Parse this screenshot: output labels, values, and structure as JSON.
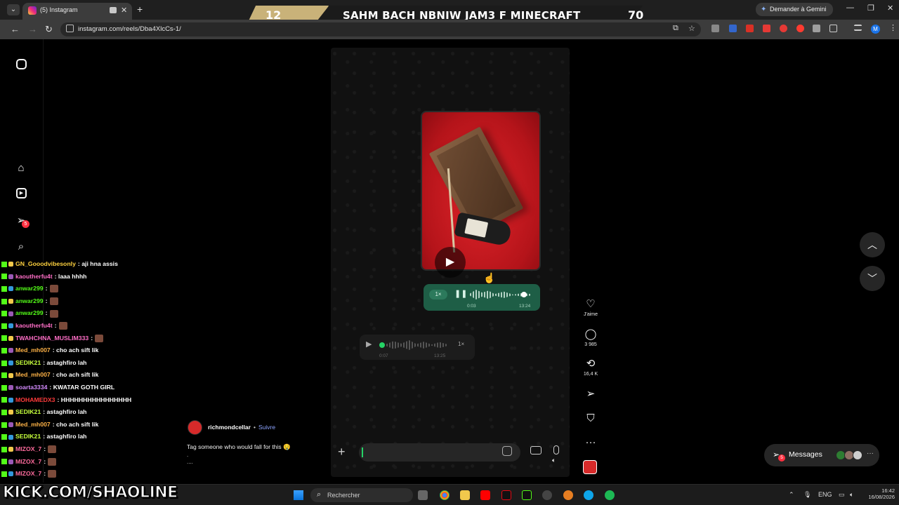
{
  "browser": {
    "tab_title": "(5) Instagram",
    "new_tab": "+",
    "url": "instagram.com/reels/Dba4XlcCs-1/",
    "gemini_label": "Demander à Gemini",
    "profile_initial": "M"
  },
  "banner": {
    "left_score": "12",
    "title": "SAHM BACH NBNIW JAM3 F MINECRAFT",
    "right_score": "70"
  },
  "reel": {
    "voice_note_1": {
      "speed": "1×",
      "elapsed": "0:03",
      "time": "13:24"
    },
    "voice_note_2": {
      "speed": "1×",
      "elapsed": "0:07",
      "time": "13:25"
    }
  },
  "actions": {
    "like_label": "J'aime",
    "comments_count": "3 985",
    "reposts_count": "16,4 K"
  },
  "caption": {
    "username": "richmondcellar",
    "follow": "Suivre",
    "separator": "•",
    "text": "Tag someone who would fall for this 🤤",
    "more1": ".",
    "more2": "...."
  },
  "messages": {
    "label": "Messages",
    "badge": "5"
  },
  "notifications_badge": "5",
  "chat": [
    {
      "user": "GN_Gooodvibesonly",
      "color": "#ffd23f",
      "msg": ": aji hna assis",
      "emote": false
    },
    {
      "user": "kaoutherfu4t",
      "color": "#ff6ec7",
      "msg": ": laaa hhhh",
      "emote": false
    },
    {
      "user": "anwar299",
      "color": "#53fc18",
      "msg": ":",
      "emote": true
    },
    {
      "user": "anwar299",
      "color": "#53fc18",
      "msg": ":",
      "emote": true
    },
    {
      "user": "anwar299",
      "color": "#53fc18",
      "msg": ":",
      "emote": true
    },
    {
      "user": "kaoutherfu4t",
      "color": "#ff6ec7",
      "msg": ":",
      "emote": true
    },
    {
      "user": "TWAHCHNA_MUSLIM333",
      "color": "#ff6ec7",
      "msg": ":",
      "emote": true
    },
    {
      "user": "Med_mh007",
      "color": "#ffb347",
      "msg": ": cho ach sift lik",
      "emote": false
    },
    {
      "user": "SEDIK21",
      "color": "#c6ff3d",
      "msg": ": astaghfiro lah",
      "emote": false
    },
    {
      "user": "Med_mh007",
      "color": "#ffb347",
      "msg": ": cho ach sift lik",
      "emote": false
    },
    {
      "user": "soarta3334",
      "color": "#d58cff",
      "msg": ": KWATAR GOTH GIRL",
      "emote": false
    },
    {
      "user": "MOHAMEDX3",
      "color": "#ff3b3b",
      "msg": ": HHHHHHHHHHHHHHHH",
      "emote": false
    },
    {
      "user": "SEDIK21",
      "color": "#c6ff3d",
      "msg": ": astaghfiro lah",
      "emote": false
    },
    {
      "user": "Med_mh007",
      "color": "#ffb347",
      "msg": ": cho ach sift lik",
      "emote": false
    },
    {
      "user": "SEDIK21",
      "color": "#c6ff3d",
      "msg": ": astaghfiro lah",
      "emote": false
    },
    {
      "user": "MIZOX_7",
      "color": "#ff6b9d",
      "msg": ":",
      "emote": true
    },
    {
      "user": "MIZOX_7",
      "color": "#ff6b9d",
      "msg": ":",
      "emote": true
    },
    {
      "user": "MIZOX_7",
      "color": "#ff6b9d",
      "msg": ":",
      "emote": true
    }
  ],
  "kick": {
    "k": "K",
    "rest": "KICK.COM/SHAOLINE"
  },
  "taskbar": {
    "search_placeholder": "Rechercher",
    "lang": "ENG",
    "time": "16:42",
    "date": "16/08/2026"
  },
  "icons": {
    "instagram": "instagram-icon",
    "home": "home-icon",
    "reels": "reels-icon",
    "messages": "paper-plane-icon",
    "search": "search-icon",
    "like": "heart-icon",
    "comment": "comment-icon",
    "repost": "repost-icon",
    "share": "paper-plane-icon",
    "save": "bookmark-icon",
    "more": "ellipsis-icon"
  }
}
